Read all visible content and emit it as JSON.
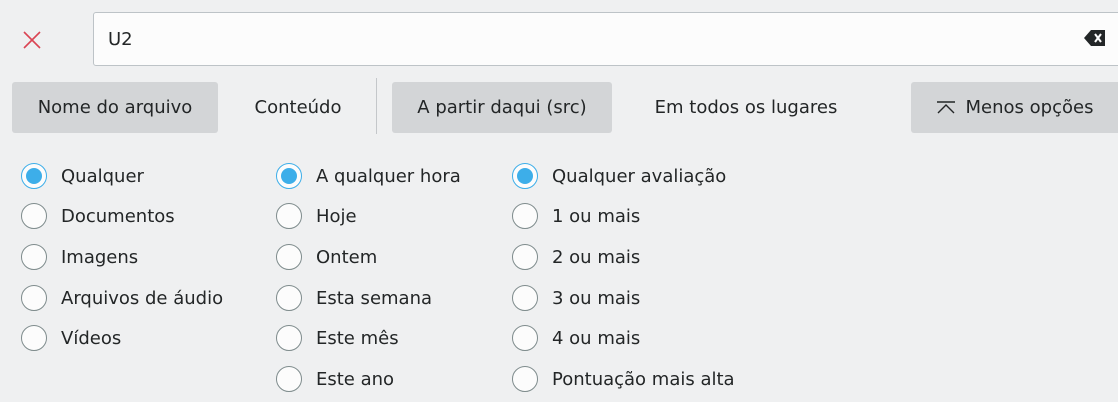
{
  "search": {
    "value": "U2"
  },
  "tabs": {
    "filename": "Nome do arquivo",
    "content": "Conteúdo",
    "from_here": "A partir daqui (src)",
    "everywhere": "Em todos os lugares",
    "less_options": "Menos opções"
  },
  "type_filter": [
    {
      "label": "Qualquer",
      "checked": true
    },
    {
      "label": "Documentos",
      "checked": false
    },
    {
      "label": "Imagens",
      "checked": false
    },
    {
      "label": "Arquivos de áudio",
      "checked": false
    },
    {
      "label": "Vídeos",
      "checked": false
    }
  ],
  "date_filter": [
    {
      "label": "A qualquer hora",
      "checked": true
    },
    {
      "label": "Hoje",
      "checked": false
    },
    {
      "label": "Ontem",
      "checked": false
    },
    {
      "label": "Esta semana",
      "checked": false
    },
    {
      "label": "Este mês",
      "checked": false
    },
    {
      "label": "Este ano",
      "checked": false
    }
  ],
  "rating_filter": [
    {
      "label": "Qualquer avaliação",
      "checked": true
    },
    {
      "label": "1 ou mais",
      "checked": false
    },
    {
      "label": "2 ou mais",
      "checked": false
    },
    {
      "label": "3 ou mais",
      "checked": false
    },
    {
      "label": "4 ou mais",
      "checked": false
    },
    {
      "label": "Pontuação mais alta",
      "checked": false
    }
  ],
  "colors": {
    "accent": "#3daee9",
    "close": "#da4453",
    "tab_active": "#d3d5d7"
  }
}
